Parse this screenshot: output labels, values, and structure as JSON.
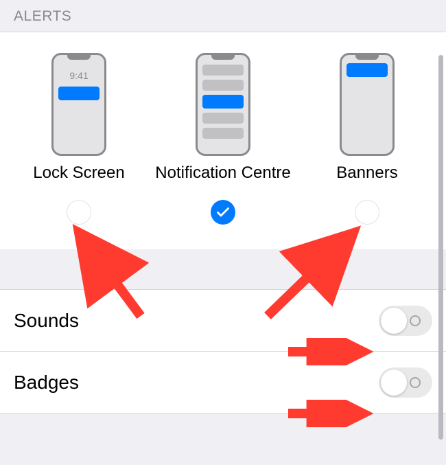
{
  "section_header": "ALERTS",
  "alerts": {
    "options": [
      {
        "label": "Lock Screen",
        "checked": false,
        "time": "9:41"
      },
      {
        "label": "Notification Centre",
        "checked": true
      },
      {
        "label": "Banners",
        "checked": false
      }
    ]
  },
  "rows": {
    "sounds": {
      "label": "Sounds",
      "on": false
    },
    "badges": {
      "label": "Badges",
      "on": false
    }
  },
  "colors": {
    "accent": "#007aff",
    "annotation": "#ff3b30"
  }
}
